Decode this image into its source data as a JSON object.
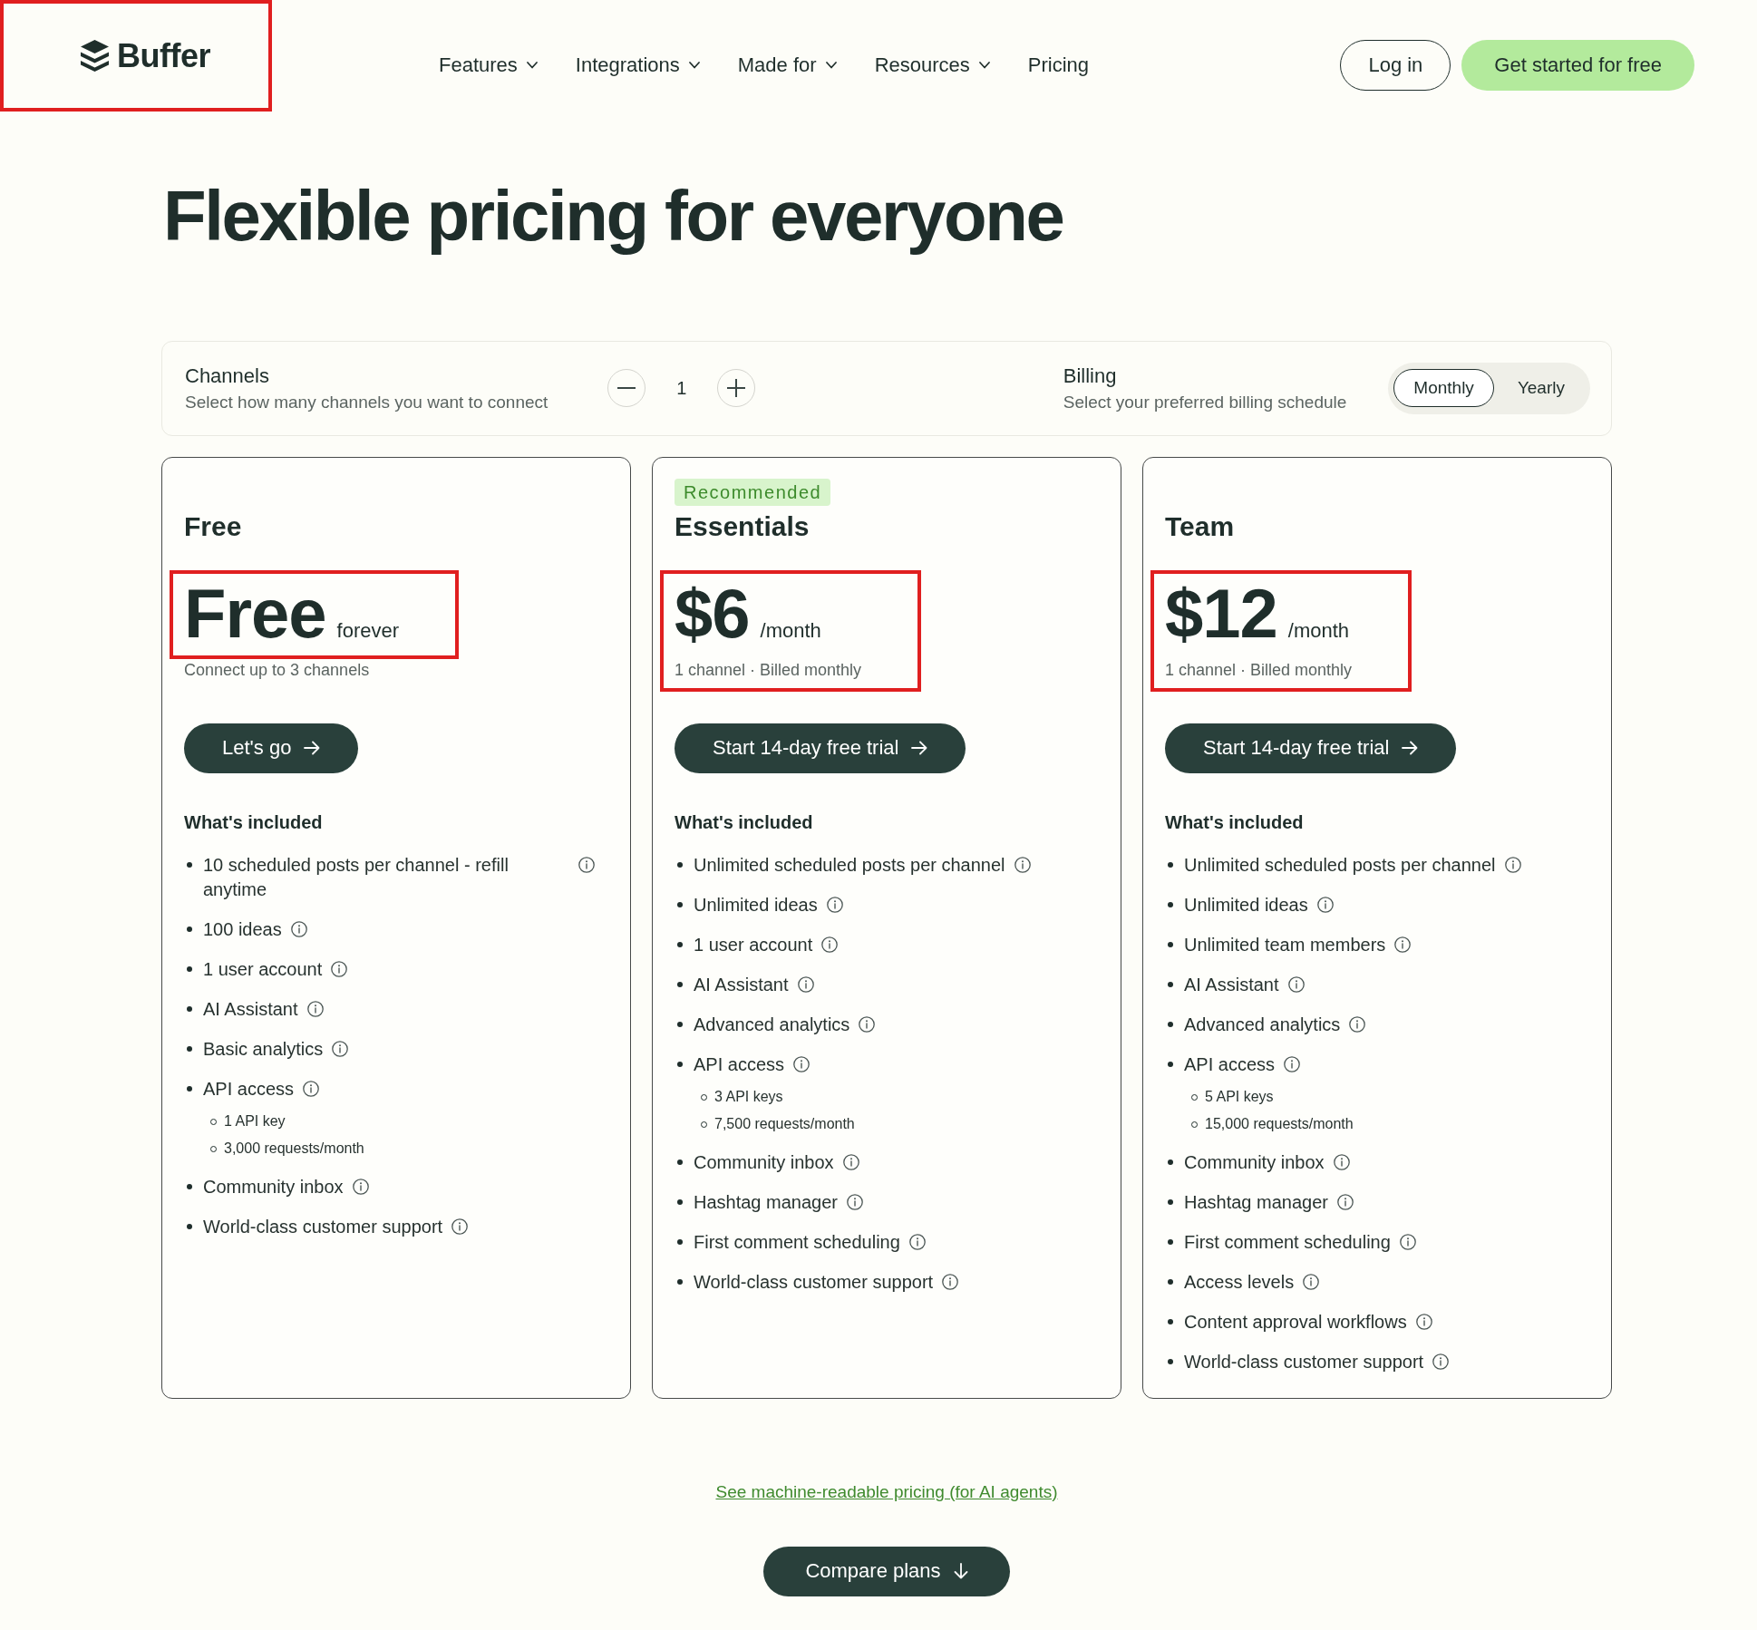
{
  "header": {
    "logo": {
      "text": "Buffer",
      "highlighted": true
    },
    "nav": [
      {
        "label": "Features",
        "dropdown": true
      },
      {
        "label": "Integrations",
        "dropdown": true
      },
      {
        "label": "Made for",
        "dropdown": true
      },
      {
        "label": "Resources",
        "dropdown": true
      },
      {
        "label": "Pricing",
        "dropdown": false
      }
    ],
    "login": "Log in",
    "cta": "Get started for free"
  },
  "title": "Flexible pricing for everyone",
  "controls": {
    "channels": {
      "label": "Channels",
      "description": "Select how many channels you want to connect",
      "value": "1"
    },
    "billing": {
      "label": "Billing",
      "description": "Select your preferred billing schedule",
      "options": [
        {
          "label": "Monthly",
          "selected": true
        },
        {
          "label": "Yearly",
          "selected": false
        }
      ]
    }
  },
  "plans": [
    {
      "name": "Free",
      "price": "Free",
      "unit": "forever",
      "note": "Connect up to 3 channels",
      "price_highlighted": true,
      "note_highlighted": false,
      "button": "Let's go",
      "features_heading": "What's included",
      "features": [
        {
          "text": "10 scheduled posts per channel - refill anytime"
        },
        {
          "text": "100 ideas"
        },
        {
          "text": "1 user account"
        },
        {
          "text": "AI Assistant"
        },
        {
          "text": "Basic analytics"
        },
        {
          "text": "API access",
          "children": [
            {
              "text": "1 API key"
            },
            {
              "text": "3,000 requests/month"
            }
          ]
        },
        {
          "text": "Community inbox"
        },
        {
          "text": "World-class customer support"
        }
      ]
    },
    {
      "badge": "Recommended",
      "name": "Essentials",
      "price": "$6",
      "unit": "/month",
      "note": "1 channel · Billed monthly",
      "price_highlighted": true,
      "note_highlighted": true,
      "button": "Start 14-day free trial",
      "features_heading": "What's included",
      "features": [
        {
          "text": "Unlimited scheduled posts per channel"
        },
        {
          "text": "Unlimited ideas"
        },
        {
          "text": "1 user account"
        },
        {
          "text": "AI Assistant"
        },
        {
          "text": "Advanced analytics"
        },
        {
          "text": "API access",
          "children": [
            {
              "text": "3 API keys"
            },
            {
              "text": "7,500 requests/month"
            }
          ]
        },
        {
          "text": "Community inbox"
        },
        {
          "text": "Hashtag manager"
        },
        {
          "text": "First comment scheduling"
        },
        {
          "text": "World-class customer support"
        }
      ]
    },
    {
      "name": "Team",
      "price": "$12",
      "unit": "/month",
      "note": "1 channel · Billed monthly",
      "price_highlighted": true,
      "note_highlighted": true,
      "button": "Start 14-day free trial",
      "features_heading": "What's included",
      "features": [
        {
          "text": "Unlimited scheduled posts per channel"
        },
        {
          "text": "Unlimited ideas"
        },
        {
          "text": "Unlimited team members"
        },
        {
          "text": "AI Assistant"
        },
        {
          "text": "Advanced analytics"
        },
        {
          "text": "API access",
          "children": [
            {
              "text": "5 API keys"
            },
            {
              "text": "15,000 requests/month"
            }
          ]
        },
        {
          "text": "Community inbox"
        },
        {
          "text": "Hashtag manager"
        },
        {
          "text": "First comment scheduling"
        },
        {
          "text": "Access levels"
        },
        {
          "text": "Content approval workflows"
        },
        {
          "text": "World-class customer support"
        }
      ]
    }
  ],
  "footer": {
    "link": "See machine-readable pricing (for AI agents)",
    "button": "Compare plans"
  }
}
